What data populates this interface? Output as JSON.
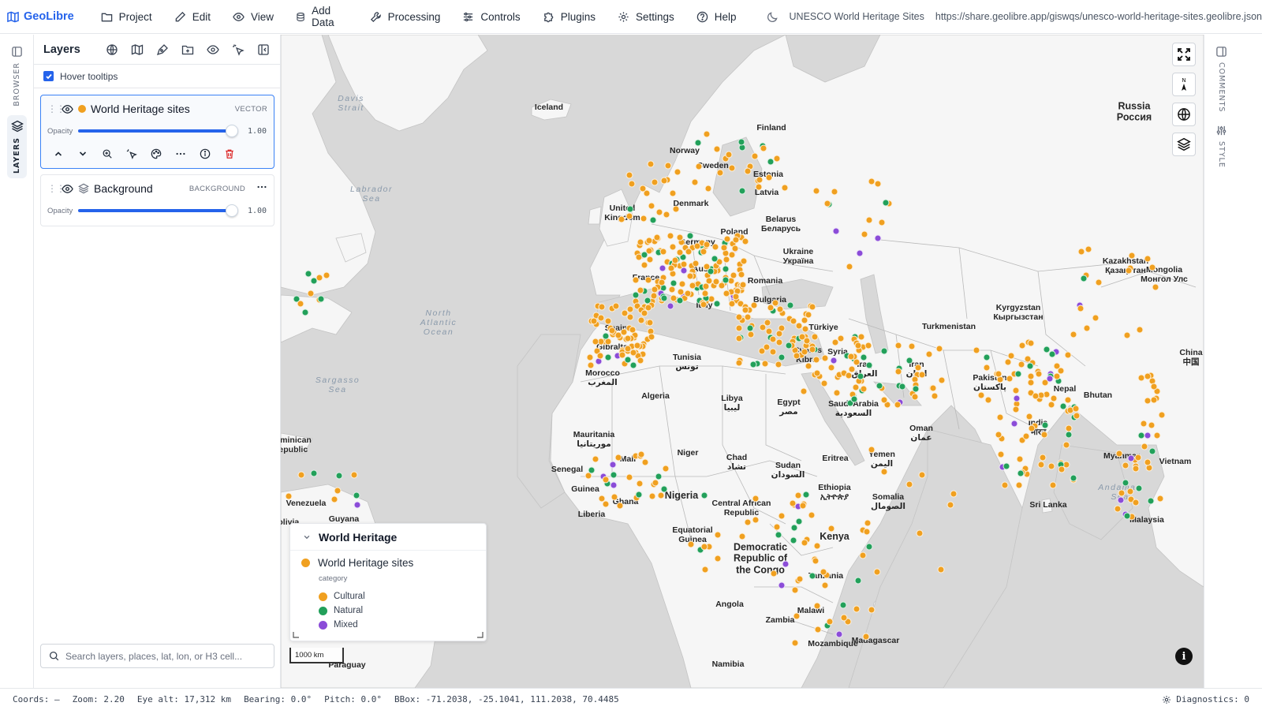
{
  "app": {
    "name": "GeoLibre"
  },
  "menu": [
    {
      "label": "Project",
      "icon": "folder-icon"
    },
    {
      "label": "Edit",
      "icon": "pencil-icon"
    },
    {
      "label": "View",
      "icon": "eye-icon"
    },
    {
      "label": "Add Data",
      "icon": "database-icon"
    },
    {
      "label": "Processing",
      "icon": "wrench-icon"
    },
    {
      "label": "Controls",
      "icon": "sliders-icon"
    },
    {
      "label": "Plugins",
      "icon": "puzzle-icon"
    },
    {
      "label": "Settings",
      "icon": "gear-icon"
    },
    {
      "label": "Help",
      "icon": "help-circle-icon"
    }
  ],
  "project": {
    "title": "UNESCO World Heritage Sites",
    "url": "https://share.geolibre.app/giswqs/unesco-world-heritage-sites.geolibre.json"
  },
  "left_rail": {
    "browser": "BROWSER",
    "layers": "LAYERS"
  },
  "right_rail": {
    "comments": "COMMENTS",
    "style": "STYLE"
  },
  "layers_panel": {
    "title": "Layers",
    "hover_tooltips": "Hover tooltips",
    "hover_tooltips_checked": true,
    "search_placeholder": "Search layers, places, lat, lon, or H3 cell...",
    "opacity_label": "Opacity",
    "layers": [
      {
        "name": "World Heritage sites",
        "type": "VECTOR",
        "opacity": "1.00",
        "opacity_fraction": 1.0,
        "visible": true,
        "color": "#f0a020"
      },
      {
        "name": "Background",
        "type": "BACKGROUND",
        "opacity": "1.00",
        "opacity_fraction": 1.0,
        "visible": true
      }
    ]
  },
  "legend": {
    "title": "World Heritage",
    "layer": "World Heritage sites",
    "field": "category",
    "entries": [
      {
        "label": "Cultural",
        "color": "#f0a020"
      },
      {
        "label": "Natural",
        "color": "#22a05a"
      },
      {
        "label": "Mixed",
        "color": "#8b4cd8"
      }
    ]
  },
  "map": {
    "scale": "1000 km",
    "colors": {
      "land": "#f6f6f6",
      "water": "#d8d8d8",
      "border": "#b9b9b9"
    },
    "labels": [
      {
        "text": "Russia\nРоссия",
        "kind": "big"
      },
      {
        "text": "Davis\nStrait",
        "kind": "sea"
      },
      {
        "text": "Labrador\nSea",
        "kind": "sea"
      },
      {
        "text": "North\nAtlantic\nOcean",
        "kind": "sea"
      },
      {
        "text": "Sargasso\nSea",
        "kind": "sea"
      },
      {
        "text": "Andaman\nSea",
        "kind": "sea"
      },
      {
        "text": "Iceland"
      },
      {
        "text": "Finland"
      },
      {
        "text": "Norway"
      },
      {
        "text": "Sweden"
      },
      {
        "text": "Estonia"
      },
      {
        "text": "Latvia"
      },
      {
        "text": "United\nKingdom"
      },
      {
        "text": "Denmark"
      },
      {
        "text": "Belarus\nБеларусь"
      },
      {
        "text": "Poland"
      },
      {
        "text": "Germany"
      },
      {
        "text": "Ukraine\nУкраїна"
      },
      {
        "text": "Kazakhstan\nҚазақстан"
      },
      {
        "text": "Mongolia\nМонгол Улс"
      },
      {
        "text": "France"
      },
      {
        "text": "Austria"
      },
      {
        "text": "Romania"
      },
      {
        "text": "Italy"
      },
      {
        "text": "Bulgaria"
      },
      {
        "text": "Kyrgyzstan\nКыргызстан"
      },
      {
        "text": "Turkmenistan"
      },
      {
        "text": "Türkiye"
      },
      {
        "text": "Spain"
      },
      {
        "text": "Gibraltar"
      },
      {
        "text": "Cyprus\nKıbrıs"
      },
      {
        "text": "Syria"
      },
      {
        "text": "Iraq\nالعراق"
      },
      {
        "text": "Iran\nایران"
      },
      {
        "text": "China\n中国"
      },
      {
        "text": "Tunisia\nتونس"
      },
      {
        "text": "Morocco\nالمغرب"
      },
      {
        "text": "Algeria"
      },
      {
        "text": "Libya\nليبيا"
      },
      {
        "text": "Egypt\nمصر"
      },
      {
        "text": "Saudi Arabia\nالسعودية"
      },
      {
        "text": "Pakistan\nپاکستان"
      },
      {
        "text": "Nepal"
      },
      {
        "text": "Bhutan"
      },
      {
        "text": "India\nभारत"
      },
      {
        "text": "Oman\nعمان"
      },
      {
        "text": "Mauritania\nموريتانيا"
      },
      {
        "text": "Mali"
      },
      {
        "text": "Niger"
      },
      {
        "text": "Chad\nتشاد"
      },
      {
        "text": "Sudan\nالسودان"
      },
      {
        "text": "Eritrea"
      },
      {
        "text": "Yemen\nاليمن"
      },
      {
        "text": "Senegal"
      },
      {
        "text": "Guinea"
      },
      {
        "text": "Ghana"
      },
      {
        "text": "Liberia"
      },
      {
        "text": "Nigeria",
        "kind": "big"
      },
      {
        "text": "Central African\nRepublic"
      },
      {
        "text": "Ethiopia\nኢትዮጵያ"
      },
      {
        "text": "Somalia\nالصومال"
      },
      {
        "text": "Myanmar"
      },
      {
        "text": "Vietnam"
      },
      {
        "text": "Sri Lanka"
      },
      {
        "text": "Malaysia"
      },
      {
        "text": "Equatorial\nGuinea"
      },
      {
        "text": "Democratic\nRepublic of\nthe Congo",
        "kind": "big"
      },
      {
        "text": "Kenya",
        "kind": "big"
      },
      {
        "text": "Tanzania"
      },
      {
        "text": "Angola"
      },
      {
        "text": "Zambia"
      },
      {
        "text": "Malawi"
      },
      {
        "text": "Mozambique"
      },
      {
        "text": "Madagascar"
      },
      {
        "text": "Namibia"
      },
      {
        "text": "Venezuela"
      },
      {
        "text": "Guyana"
      },
      {
        "text": "Dominican\nRepublic"
      },
      {
        "text": "Paraguay"
      },
      {
        "text": "Bolivia"
      }
    ]
  },
  "status": {
    "coords": "Coords: —",
    "zoom": "Zoom: 2.20",
    "eye_alt": "Eye alt: 17,312 km",
    "bearing": "Bearing: 0.0°",
    "pitch": "Pitch: 0.0°",
    "bbox": "BBox: -71.2038, -25.1041, 111.2038, 70.4485",
    "diagnostics": "Diagnostics: 0"
  }
}
